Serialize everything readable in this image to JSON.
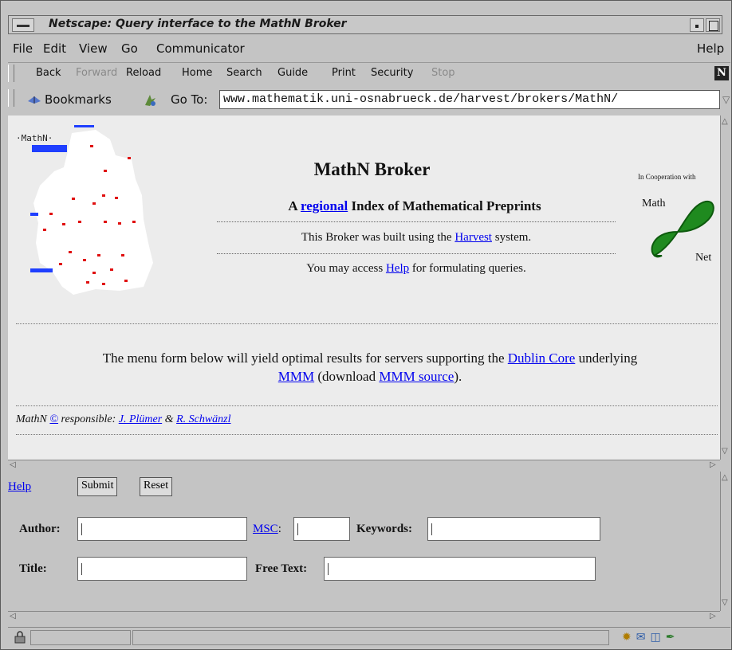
{
  "window": {
    "title": "Netscape: Query interface to the MathN Broker"
  },
  "menu": [
    "File",
    "Edit",
    "View",
    "Go",
    "Communicator",
    "Help"
  ],
  "toolbar": {
    "back": "Back",
    "forward": "Forward",
    "reload": "Reload",
    "home": "Home",
    "search": "Search",
    "guide": "Guide",
    "print": "Print",
    "security": "Security",
    "stop": "Stop"
  },
  "location": {
    "bookmarks": "Bookmarks",
    "goto_label": "Go To:",
    "url": "www.mathematik.uni-osnabrueck.de/harvest/brokers/MathN/"
  },
  "header": {
    "map_label": "·MathN·",
    "title": "MathN Broker",
    "subtitle_pre": "A ",
    "subtitle_link": "regional",
    "subtitle_post": " Index of Mathematical Preprints",
    "line1_pre": "This Broker was built using the ",
    "line1_link": "Harvest",
    "line1_post": " system.",
    "line2_pre": "You may access ",
    "line2_link": "Help",
    "line2_post": " for formulating queries.",
    "coop": "In Cooperation with",
    "logo_math": "Math",
    "logo_net": "Net"
  },
  "menu_text": {
    "pre": "The menu form below will yield optimal results for servers supporting the ",
    "dublin_core": "Dublin Core",
    "mid": " underlying",
    "mmm": "MMM",
    "mid2": " (download ",
    "mmm_source": "MMM source",
    "post": ")."
  },
  "responsible": {
    "pre": "MathN ",
    "copyright": "©",
    "mid": " responsible: ",
    "person1": "J. Plümer",
    "and": " & ",
    "person2": "R. Schwänzl"
  },
  "form": {
    "help": "Help",
    "submit": "Submit",
    "reset": "Reset",
    "author_label": "Author:",
    "msc_label": "MSC",
    "msc_colon": ":",
    "keywords_label": "Keywords:",
    "title_label": "Title:",
    "freetext_label": "Free Text:",
    "author_value": "",
    "msc_value": "",
    "keywords_value": "",
    "title_value": "",
    "freetext_value": ""
  },
  "colors": {
    "link": "#0000ee",
    "page_bg": "#ececec",
    "chrome": "#c4c4c4"
  }
}
